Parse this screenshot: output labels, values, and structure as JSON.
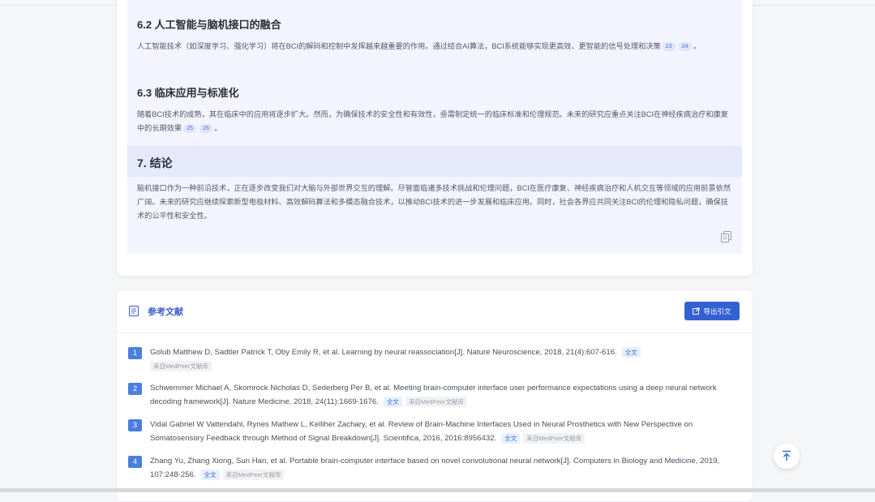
{
  "article": {
    "sections": [
      {
        "heading": "6.2 人工智能与脑机接口的融合",
        "text_before": "人工智能技术（如深度学习、强化学习）将在BCI的解码和控制中发挥越来越重要的作用。通过结合AI算法，BCI系统能够实现更高效、更智能的信号处理和决策",
        "cites": [
          "23",
          "24"
        ],
        "text_after": "。"
      },
      {
        "heading": "6.3 临床应用与标准化",
        "text_before": "随着BCI技术的成熟，其在临床中的应用将逐步扩大。然而，为确保技术的安全性和有效性，亟需制定统一的临床标准和伦理规范。未来的研究应重点关注BCI在神经疾病治疗和康复中的长期效果",
        "cites": [
          "25",
          "26"
        ],
        "text_after": "。"
      }
    ],
    "conclusion": {
      "heading": "7. 结论",
      "text": "脑机接口作为一种前沿技术，正在逐步改变我们对大脑与外部世界交互的理解。尽管面临诸多技术挑战和伦理问题，BCI在医疗康复、神经疾病治疗和人机交互等领域的应用前景依然广阔。未来的研究应继续探索新型电极材料、高效解码算法和多模态融合技术，以推动BCI技术的进一步发展和临床应用。同时，社会各界应共同关注BCI的伦理和隐私问题，确保技术的公平性和安全性。"
    }
  },
  "references": {
    "title": "参考文献",
    "export_label": "导出引文",
    "full_text_label": "全文",
    "source_label": "来自MedPeer文献库",
    "items": [
      {
        "num": "1",
        "text": "Golub Matthew D, Sadtler Patrick T, Oby Emily R, et al. Learning by neural reassociation[J]. Nature Neuroscience, 2018, 21(4):607-616."
      },
      {
        "num": "2",
        "text": "Schwemmer Michael A, Skomrock Nicholas D, Sederberg Per B, et al. Meeting brain-computer interface user performance expectations using a deep neural network decoding framework[J]. Nature Medicine, 2018, 24(11):1669-1676."
      },
      {
        "num": "3",
        "text": "Vidal Gabriel W Vattendahl, Rynes Mathew L, Kelliher Zachary, et al. Review of Brain-Machine Interfaces Used in Neural Prosthetics with New Perspective on Somatosensory Feedback through Method of Signal Breakdown[J]. Scientifica, 2016, 2016:8956432."
      },
      {
        "num": "4",
        "text": "Zhang Yu, Zhang Xiong, Sun Han, et al. Portable brain-computer interface based on novel convolutional neural network[J]. Computers in Biology and Medicine, 2019, 107:248-256."
      }
    ]
  }
}
